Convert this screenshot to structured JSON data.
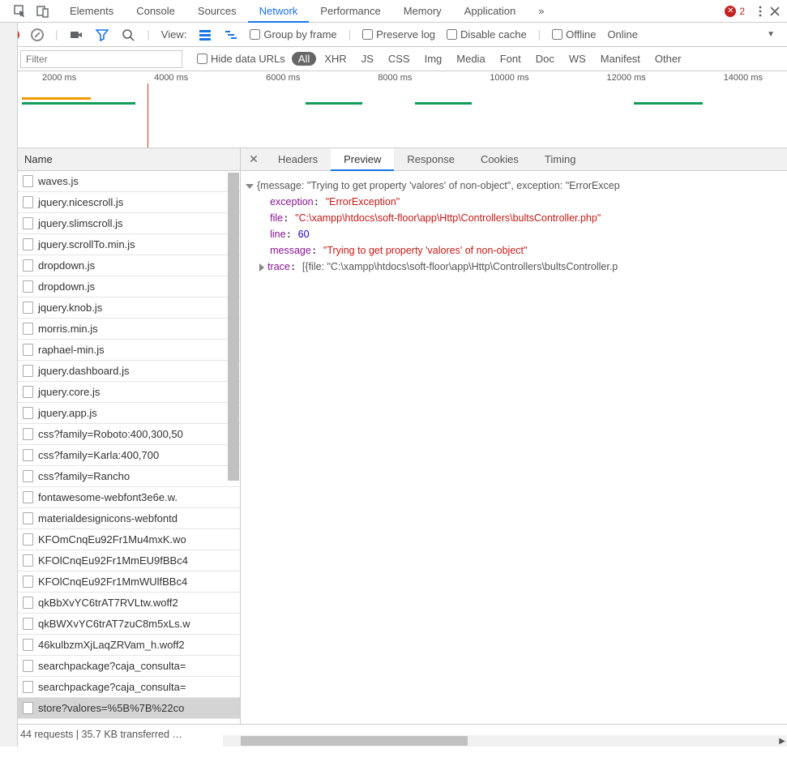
{
  "topTabs": [
    "Elements",
    "Console",
    "Sources",
    "Network",
    "Performance",
    "Memory",
    "Application"
  ],
  "activeTopTab": "Network",
  "moreTabsGlyph": "»",
  "errorCount": "2",
  "toolbar": {
    "viewLabel": "View:",
    "groupByFrame": "Group by frame",
    "preserveLog": "Preserve log",
    "disableCache": "Disable cache",
    "offline": "Offline",
    "online": "Online"
  },
  "filter": {
    "placeholder": "Filter",
    "hideDataUrls": "Hide data URLs",
    "pills": [
      "All",
      "XHR",
      "JS",
      "CSS",
      "Img",
      "Media",
      "Font",
      "Doc",
      "WS",
      "Manifest",
      "Other"
    ],
    "activePill": "All"
  },
  "timeline": {
    "ticks": [
      "2000 ms",
      "4000 ms",
      "6000 ms",
      "8000 ms",
      "10000 ms",
      "12000 ms",
      "14000 ms"
    ]
  },
  "leftHeader": "Name",
  "requests": [
    "waves.js",
    "jquery.nicescroll.js",
    "jquery.slimscroll.js",
    "jquery.scrollTo.min.js",
    "dropdown.js",
    "dropdown.js",
    "jquery.knob.js",
    "morris.min.js",
    "raphael-min.js",
    "jquery.dashboard.js",
    "jquery.core.js",
    "jquery.app.js",
    "css?family=Roboto:400,300,50",
    "css?family=Karla:400,700",
    "css?family=Rancho",
    "fontawesome-webfont3e6e.w.",
    "materialdesignicons-webfontd",
    "KFOmCnqEu92Fr1Mu4mxK.wo",
    "KFOlCnqEu92Fr1MmEU9fBBc4",
    "KFOlCnqEu92Fr1MmWUlfBBc4",
    "qkBbXvYC6trAT7RVLtw.woff2",
    "qkBWXvYC6trAT7zuC8m5xLs.w",
    "46kulbzmXjLaqZRVam_h.woff2",
    "searchpackage?caja_consulta=",
    "searchpackage?caja_consulta=",
    "store?valores=%5B%7B%22co"
  ],
  "selectedRequest": "store?valores=%5B%7B%22co",
  "rightTabs": [
    "Headers",
    "Preview",
    "Response",
    "Cookies",
    "Timing"
  ],
  "activeRightTab": "Preview",
  "previewSummary": "{message: \"Trying to get property 'valores' of non-object\", exception: \"ErrorExcep",
  "preview": {
    "exception_k": "exception",
    "exception_v": "\"ErrorException\"",
    "file_k": "file",
    "file_v": "\"C:\\xampp\\htdocs\\soft-floor\\app\\Http\\Controllers\\bultsController.php\"",
    "line_k": "line",
    "line_v": "60",
    "message_k": "message",
    "message_v": "\"Trying to get property 'valores' of non-object\"",
    "trace_k": "trace",
    "trace_v": "[{file: \"C:\\xampp\\htdocs\\soft-floor\\app\\Http\\Controllers\\bultsController.p"
  },
  "status": "44 requests  |  35.7 KB transferred  …"
}
